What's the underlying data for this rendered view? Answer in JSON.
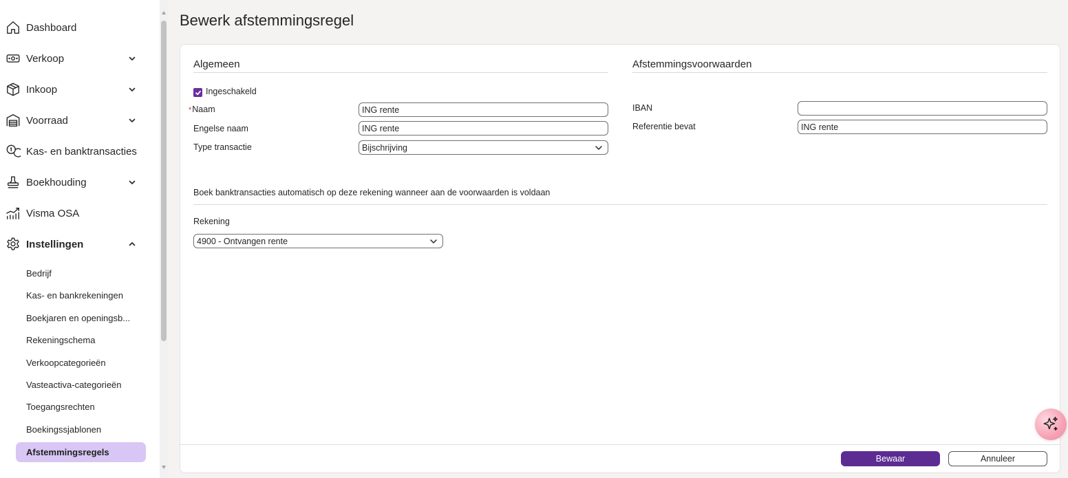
{
  "sidebar": {
    "items": [
      {
        "label": "Dashboard",
        "icon": "home-icon",
        "has_chevron": false
      },
      {
        "label": "Verkoop",
        "icon": "banknote-icon",
        "has_chevron": true
      },
      {
        "label": "Inkoop",
        "icon": "package-icon",
        "has_chevron": true
      },
      {
        "label": "Voorraad",
        "icon": "warehouse-icon",
        "has_chevron": true
      },
      {
        "label": "Kas- en banktransacties",
        "icon": "coins-icon",
        "has_chevron": false
      },
      {
        "label": "Boekhouding",
        "icon": "stamp-icon",
        "has_chevron": true
      },
      {
        "label": "Visma OSA",
        "icon": "chart-trend-icon",
        "has_chevron": false
      },
      {
        "label": "Instellingen",
        "icon": "gear-icon",
        "has_chevron": true,
        "expanded": true
      }
    ],
    "sub_items": [
      {
        "label": "Bedrijf"
      },
      {
        "label": "Kas- en bankrekeningen"
      },
      {
        "label": "Boekjaren en openingsb..."
      },
      {
        "label": "Rekeningschema"
      },
      {
        "label": "Verkoopcategorieën"
      },
      {
        "label": "Vasteactiva-categorieën"
      },
      {
        "label": "Toegangsrechten"
      },
      {
        "label": "Boekingssjablonen"
      },
      {
        "label": "Afstemmingsregels",
        "active": true
      }
    ]
  },
  "page": {
    "title": "Bewerk afstemmingsregel"
  },
  "general": {
    "heading": "Algemeen",
    "enabled_label": "Ingeschakeld",
    "enabled": true,
    "required_marker": "*",
    "name_label": "Naam",
    "name_value": "ING rente",
    "english_name_label": "Engelse naam",
    "english_name_value": "ING rente",
    "transaction_type_label": "Type transactie",
    "transaction_type_value": "Bijschrijving"
  },
  "conditions": {
    "heading": "Afstemmingsvoorwaarden",
    "iban_label": "IBAN",
    "iban_value": "",
    "reference_label": "Referentie bevat",
    "reference_value": "ING rente"
  },
  "booking": {
    "description": "Boek banktransacties automatisch op deze rekening wanneer aan de voorwaarden is voldaan",
    "account_label": "Rekening",
    "account_value": "4900 - Ontvangen rente"
  },
  "footer": {
    "save_label": "Bewaar",
    "cancel_label": "Annuleer"
  },
  "colors": {
    "primary": "#5c2c92",
    "active_nav_bg": "#d8c6f4",
    "checkbox": "#6b2fa0",
    "fab": "#f7a1b3"
  }
}
